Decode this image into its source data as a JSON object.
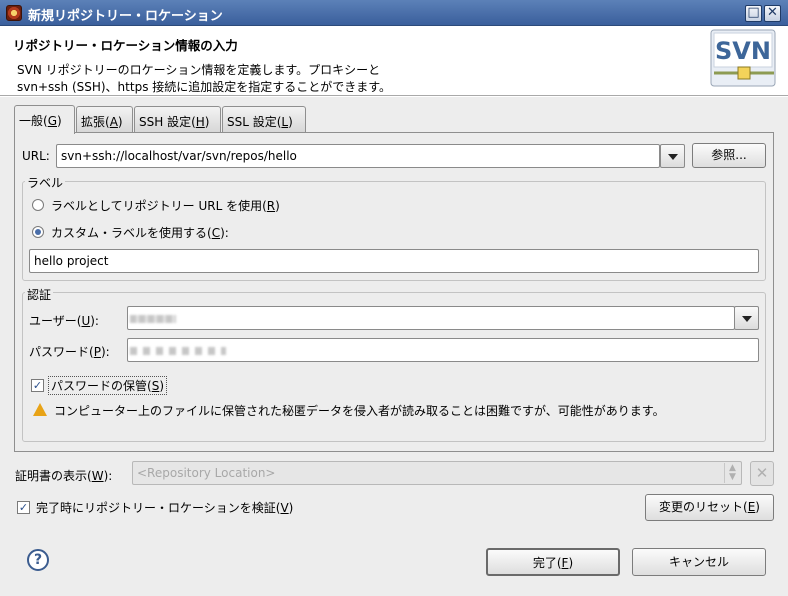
{
  "window": {
    "title": "新規リポジトリー・ロケーション",
    "maximize_glyph": "□",
    "close_glyph": "✕"
  },
  "header": {
    "title": "リポジトリー・ロケーション情報の入力",
    "desc_line1": "SVN リポジトリーのロケーション情報を定義します。プロキシーと",
    "desc_line2": "svn+ssh (SSH)、https 接続に追加設定を指定することができます。",
    "logo_text": "SVN"
  },
  "tabs": [
    {
      "label": "一般(",
      "mn": "G",
      "end": ")"
    },
    {
      "label": "拡張(",
      "mn": "A",
      "end": ")"
    },
    {
      "label": "SSH 設定(",
      "mn": "H",
      "end": ")"
    },
    {
      "label": "SSL 設定(",
      "mn": "L",
      "end": ")"
    }
  ],
  "url": {
    "label": "URL:",
    "value": "svn+ssh://localhost/var/svn/repos/hello",
    "browse_button": "参照..."
  },
  "label_group": {
    "title": "ラベル",
    "option_url": {
      "text": "ラベルとしてリポジトリー URL を使用(",
      "mn": "R",
      "end": ")",
      "selected": false
    },
    "option_custom": {
      "text": "カスタム・ラベルを使用する(",
      "mn": "C",
      "end": "):",
      "selected": true
    },
    "custom_value": "hello project"
  },
  "auth_group": {
    "title": "認証",
    "user_label": {
      "text": "ユーザー(",
      "mn": "U",
      "end": "):"
    },
    "password_label": {
      "text": "パスワード(",
      "mn": "P",
      "end": "):"
    },
    "save_password": {
      "text": "パスワードの保管(",
      "mn": "S",
      "end": ")",
      "checked": true
    },
    "warning": "コンピューター上のファイルに保管された秘匿データを侵入者が読み取ることは困難ですが、可能性があります。"
  },
  "cert": {
    "label": "証明書の表示(",
    "mn": "W",
    "end": "):",
    "placeholder": "<Repository Location>"
  },
  "validate": {
    "text": "完了時にリポジトリー・ロケーションを検証(",
    "mn": "V",
    "end": ")",
    "checked": true
  },
  "reset_button": {
    "text": "変更のリセット(",
    "mn": "E",
    "end": ")"
  },
  "finish_button": {
    "text": "完了(",
    "mn": "F",
    "end": ")"
  },
  "cancel_button": "キャンセル",
  "help_glyph": "?",
  "check_glyph": "✓",
  "colors": {
    "titlebar": "#4a6ea9",
    "accent": "#e8a317"
  }
}
